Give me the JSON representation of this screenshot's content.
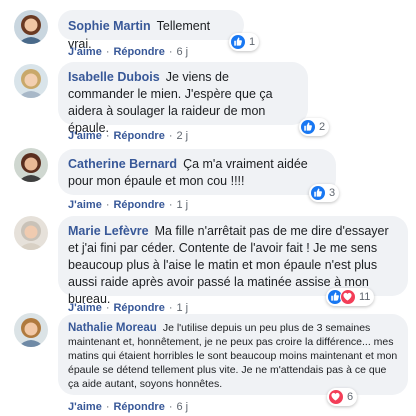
{
  "comments": [
    {
      "name": "Sophie Martin",
      "text": "Tellement vrai.",
      "actions": {
        "like": "J'aime",
        "reply": "Répondre",
        "time": "6 j"
      },
      "reactions": {
        "types": [
          "like"
        ],
        "count": "1"
      }
    },
    {
      "name": "Isabelle Dubois",
      "text": "Je viens de commander le mien. J'espère que ça aidera à soulager la raideur de mon épaule.",
      "actions": {
        "like": "J'aime",
        "reply": "Répondre",
        "time": "2 j"
      },
      "reactions": {
        "types": [
          "like"
        ],
        "count": "2"
      }
    },
    {
      "name": "Catherine Bernard",
      "text": "Ça m'a vraiment aidée pour mon épaule et mon cou !!!!",
      "actions": {
        "like": "J'aime",
        "reply": "Répondre",
        "time": "1 j"
      },
      "reactions": {
        "types": [
          "like"
        ],
        "count": "3"
      }
    },
    {
      "name": "Marie Lefèvre",
      "text": "Ma fille n'arrêtait pas de me dire d'essayer et j'ai fini par céder. Contente de l'avoir fait ! Je me sens beaucoup plus à l'aise le matin et mon épaule n'est plus aussi raide après avoir passé la matinée assise à mon bureau.",
      "actions": {
        "like": "J'aime",
        "reply": "Répondre",
        "time": "1 j"
      },
      "reactions": {
        "types": [
          "like",
          "love"
        ],
        "count": "11"
      }
    },
    {
      "name": "Nathalie Moreau",
      "text": "Je l'utilise depuis un peu plus de 3 semaines maintenant et, honnêtement, je ne peux pas croire la différence... mes matins qui étaient horribles le sont beaucoup moins maintenant et mon épaule se détend tellement plus vite. Je ne m'attendais pas à ce que ça aide autant, soyons honnêtes.",
      "actions": {
        "like": "J'aime",
        "reply": "Répondre",
        "time": "6 j"
      },
      "reactions": {
        "types": [
          "love"
        ],
        "count": "6"
      }
    }
  ],
  "colors": {
    "name": "#385898",
    "bubble": "#f0f2f5",
    "like": "#1877f2",
    "love": "#f33e58"
  }
}
